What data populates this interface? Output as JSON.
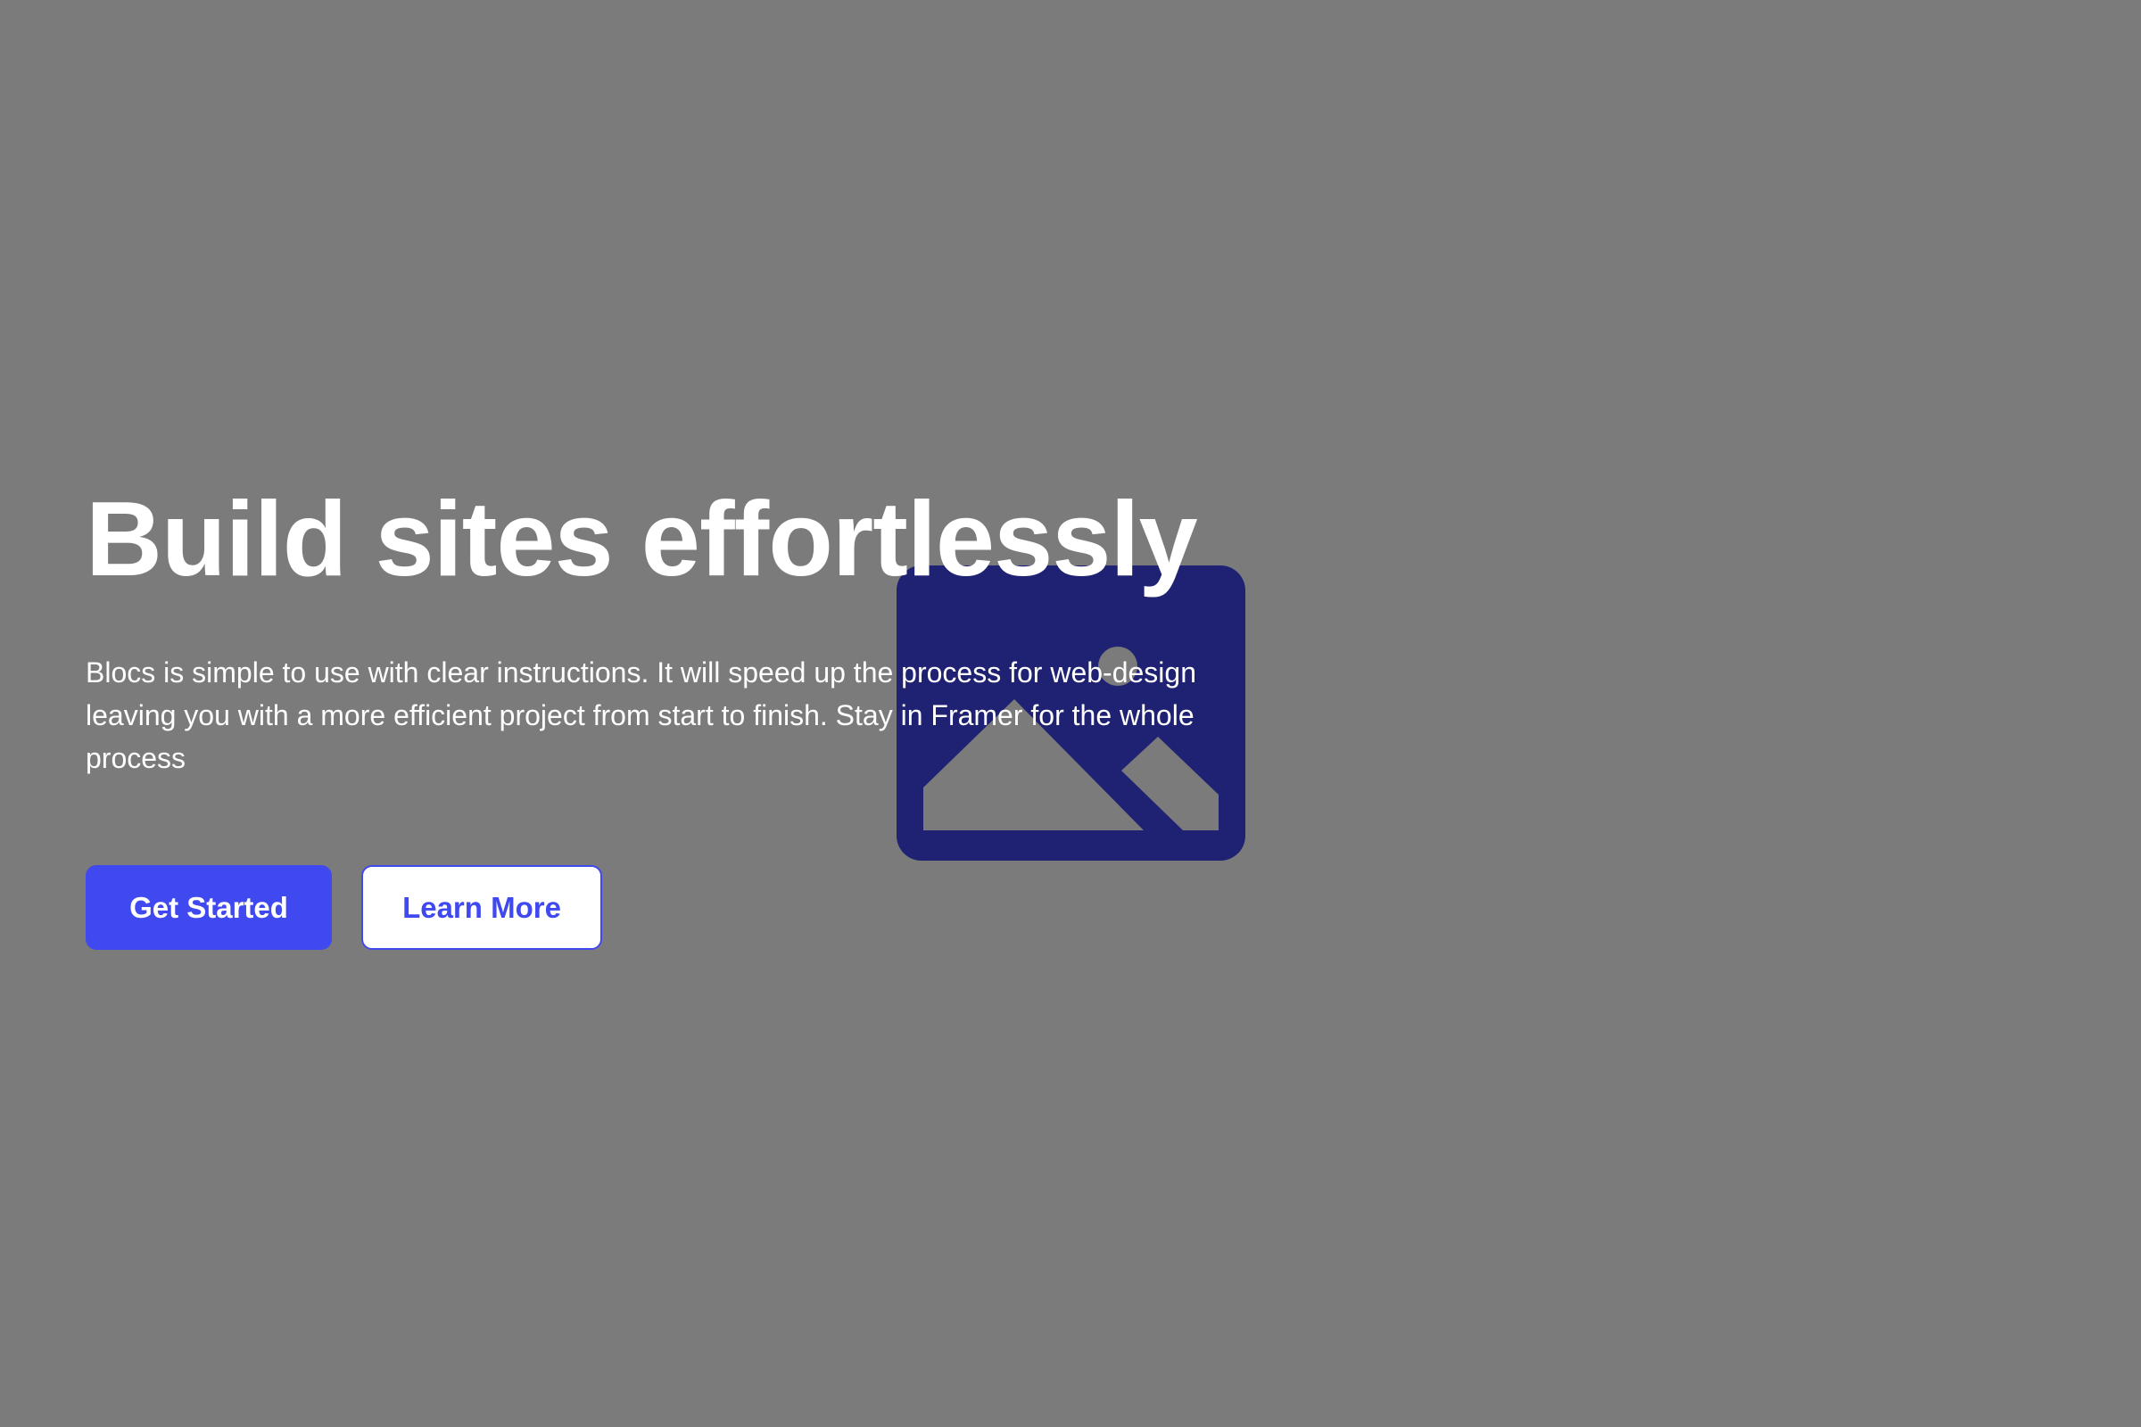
{
  "hero": {
    "title": "Build sites effortlessly",
    "description": "Blocs is simple to use with clear instructions. It will speed up the process for web-design leaving you with a more efficient project from start to finish. Stay in Framer for the whole process",
    "primary_button": "Get Started",
    "secondary_button": "Learn More",
    "image_icon": "image-placeholder-icon"
  },
  "colors": {
    "background": "#7b7b7b",
    "accent": "#4049f0",
    "image_fill": "#1f2172",
    "text": "#ffffff"
  }
}
